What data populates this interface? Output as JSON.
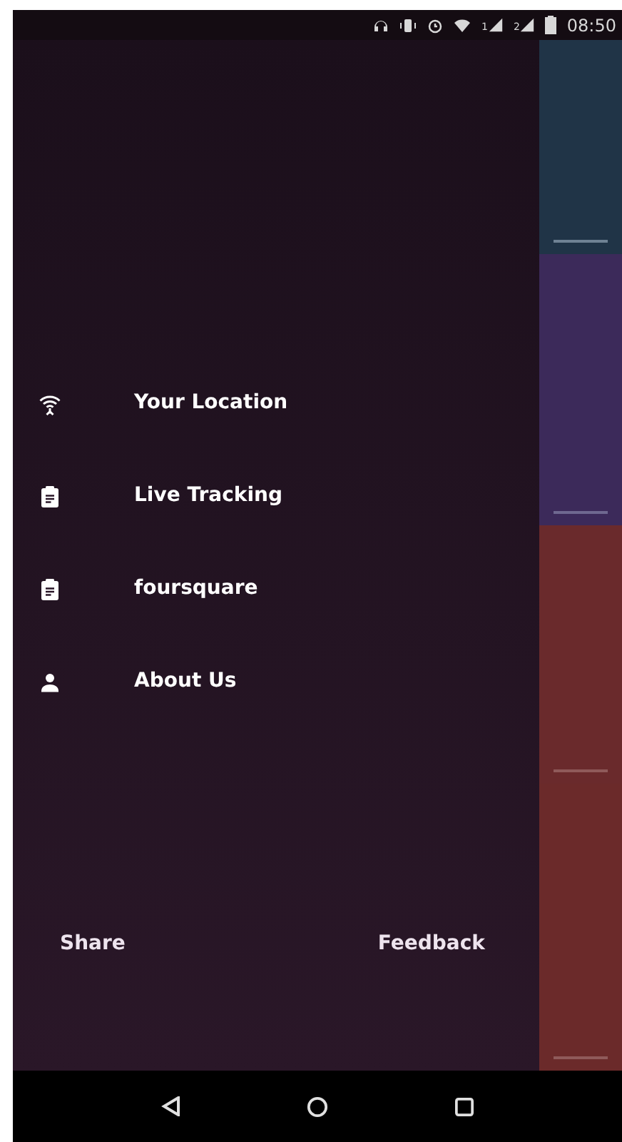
{
  "status_bar": {
    "sim_labels": [
      "1",
      "2"
    ],
    "time": "08:50"
  },
  "drawer": {
    "items": [
      {
        "label": "Your Location"
      },
      {
        "label": "Live Tracking"
      },
      {
        "label": "foursquare"
      },
      {
        "label": "About Us"
      }
    ],
    "footer": {
      "left": "Share",
      "right": "Feedback"
    }
  }
}
